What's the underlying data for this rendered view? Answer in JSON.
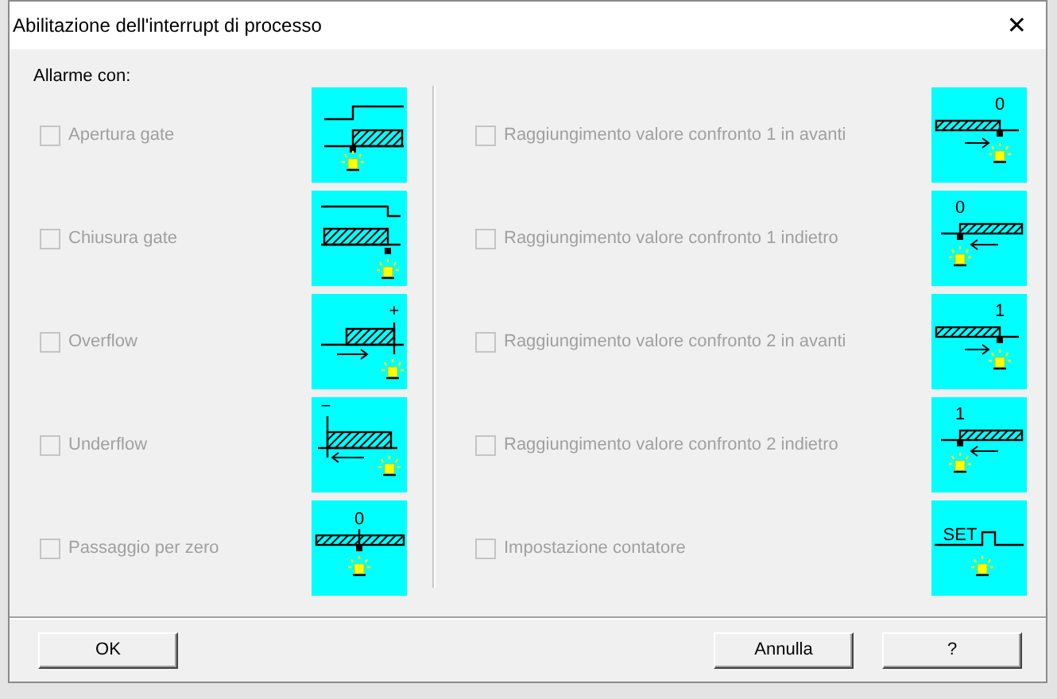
{
  "window": {
    "title": "Abilitazione dell'interrupt di processo",
    "close": "✕"
  },
  "group_label": "Allarme con:",
  "left_items": [
    {
      "label": "Apertura gate",
      "checked": false,
      "disabled": true,
      "kind": "gate-open"
    },
    {
      "label": "Chiusura gate",
      "checked": false,
      "disabled": true,
      "kind": "gate-close"
    },
    {
      "label": "Overflow",
      "checked": false,
      "disabled": true,
      "kind": "overflow",
      "icon_text": "+"
    },
    {
      "label": "Underflow",
      "checked": false,
      "disabled": true,
      "kind": "underflow",
      "icon_text": "−"
    },
    {
      "label": "Passaggio per zero",
      "checked": false,
      "disabled": true,
      "kind": "zero",
      "icon_text": "0"
    }
  ],
  "right_items": [
    {
      "label": "Raggiungimento valore confronto 1 in avanti",
      "checked": false,
      "disabled": true,
      "kind": "compare-forward",
      "icon_text": "0"
    },
    {
      "label": "Raggiungimento valore confronto 1 indietro",
      "checked": false,
      "disabled": true,
      "kind": "compare-backward",
      "icon_text": "0"
    },
    {
      "label": "Raggiungimento valore confronto 2 in avanti",
      "checked": false,
      "disabled": true,
      "kind": "compare-forward",
      "icon_text": "1"
    },
    {
      "label": "Raggiungimento valore confronto 2 indietro",
      "checked": false,
      "disabled": true,
      "kind": "compare-backward",
      "icon_text": "1"
    },
    {
      "label": "Impostazione contatore",
      "checked": false,
      "disabled": true,
      "kind": "set",
      "icon_text": "SET"
    }
  ],
  "buttons": [
    "OK",
    "Annulla",
    "?"
  ]
}
